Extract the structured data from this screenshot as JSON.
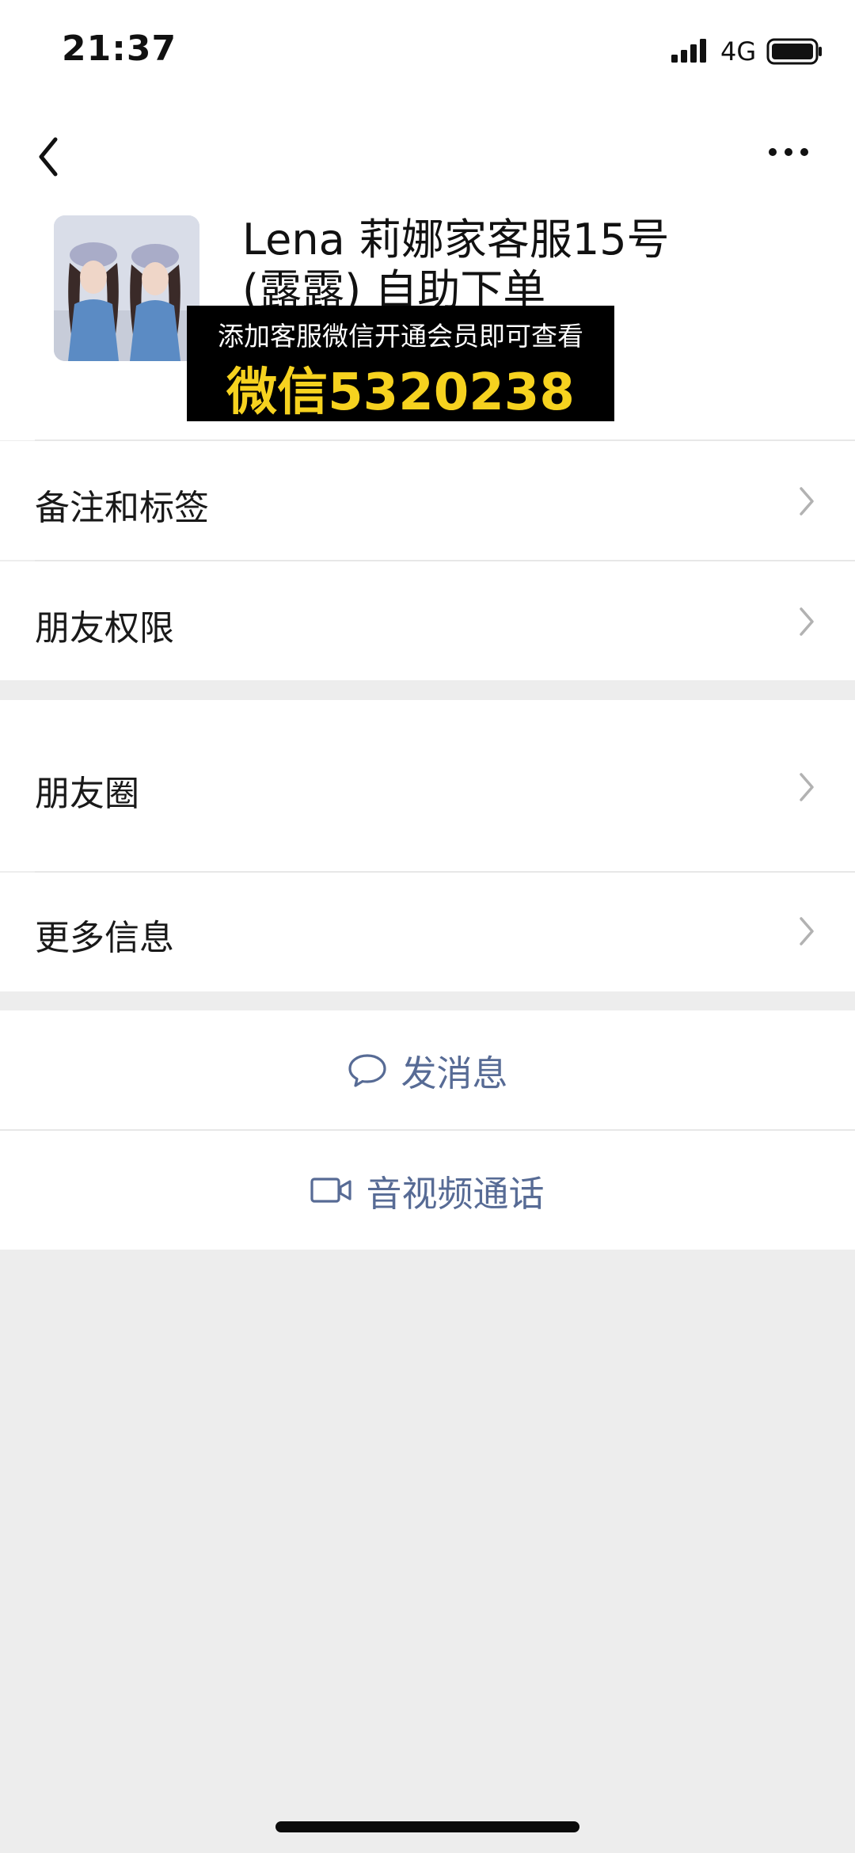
{
  "status_bar": {
    "time": "21:37",
    "network": "4G"
  },
  "header": {
    "name_line1": "Lena 莉娜家客服15号",
    "name_line2": "(露露) 自助下单",
    "avatar_icon": "avatar-photo",
    "back_icon": "chevron-left-icon",
    "more_icon": "more-dots-icon"
  },
  "promo": {
    "top_text": "添加客服微信开通会员即可查看",
    "bottom_text": "微信5320238",
    "bottom_color": "#f6d21f"
  },
  "rows": {
    "remarks_tags": "备注和标签",
    "friend_permissions": "朋友权限",
    "moments": "朋友圈",
    "more_info": "更多信息"
  },
  "actions": {
    "send_message": "发消息",
    "voice_video_call": "音视频通话",
    "link_color": "#576b95"
  }
}
